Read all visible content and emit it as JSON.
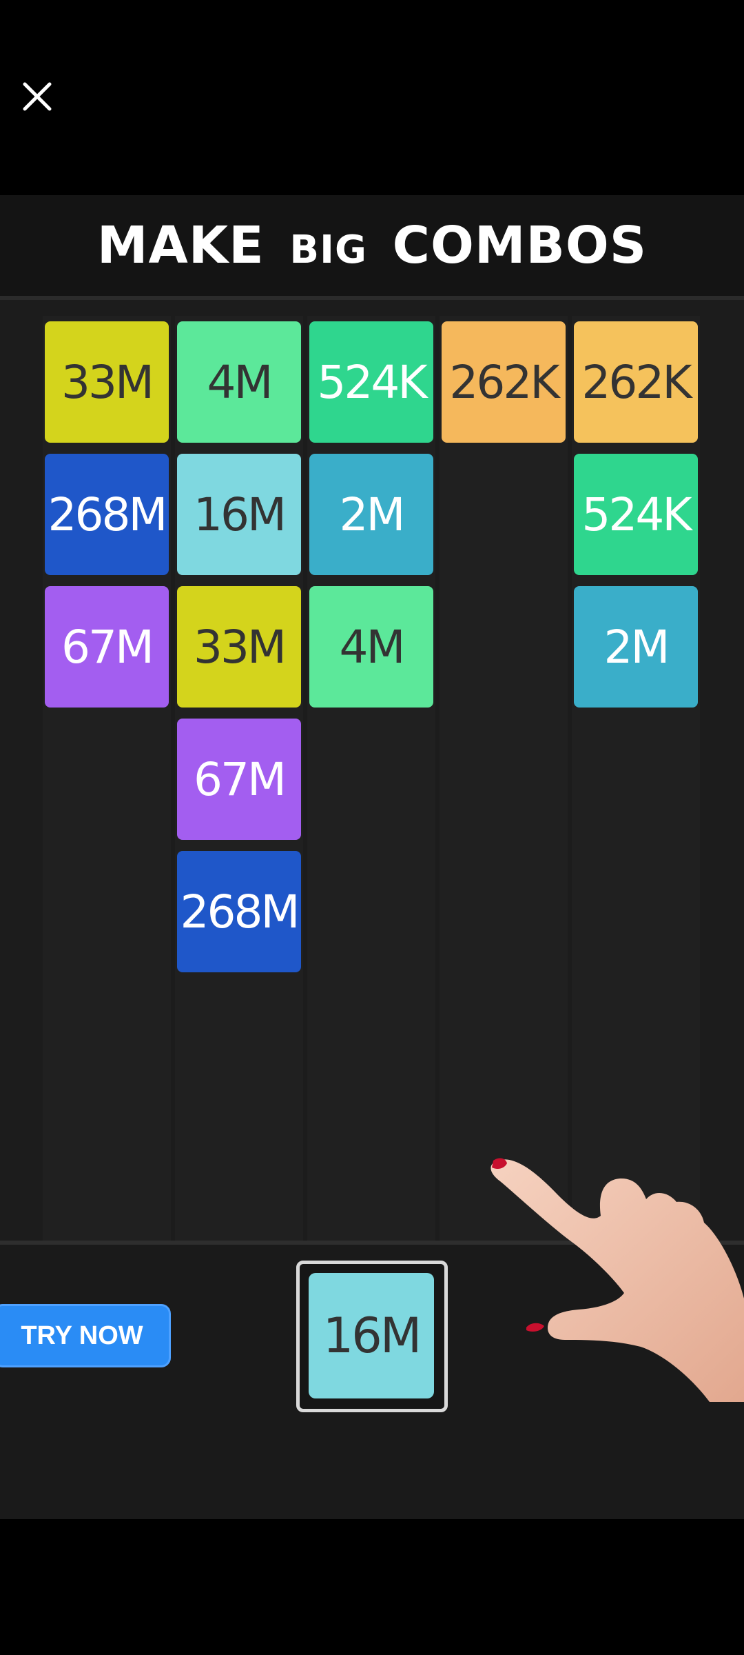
{
  "ad": {
    "headline_part1": "MAKE",
    "headline_part2": "BIG",
    "headline_part3": "COMBOS",
    "cta_label": "TRY NOW",
    "next_tile": {
      "value": "16M",
      "color": "#7fd8e0",
      "text_color": "#333333"
    }
  },
  "icons": {
    "close": "close-icon",
    "hand": "pointing-hand"
  },
  "columns": [
    {
      "tiles": [
        {
          "value": "33M",
          "color": "#d4d41c",
          "text_color": "#333333"
        },
        {
          "value": "268M",
          "color": "#1f57c9",
          "text_color": "#ffffff"
        },
        {
          "value": "67M",
          "color": "#a35ef0",
          "text_color": "#ffffff"
        }
      ]
    },
    {
      "tiles": [
        {
          "value": "4M",
          "color": "#5ce89a",
          "text_color": "#333333"
        },
        {
          "value": "16M",
          "color": "#7fd8e0",
          "text_color": "#333333"
        },
        {
          "value": "33M",
          "color": "#d4d41c",
          "text_color": "#333333"
        },
        {
          "value": "67M",
          "color": "#a35ef0",
          "text_color": "#ffffff"
        },
        {
          "value": "268M",
          "color": "#1f57c9",
          "text_color": "#ffffff"
        }
      ]
    },
    {
      "tiles": [
        {
          "value": "524K",
          "color": "#2fd68e",
          "text_color": "#ffffff"
        },
        {
          "value": "2M",
          "color": "#3aaec9",
          "text_color": "#ffffff"
        },
        {
          "value": "4M",
          "color": "#5ce89a",
          "text_color": "#333333"
        }
      ]
    },
    {
      "tiles": [
        {
          "value": "262K",
          "color": "#f5b85c",
          "text_color": "#333333"
        }
      ]
    },
    {
      "tiles": [
        {
          "value": "262K",
          "color": "#f5c25c",
          "text_color": "#333333"
        },
        {
          "value": "524K",
          "color": "#2fd68e",
          "text_color": "#ffffff"
        },
        {
          "value": "2M",
          "color": "#3aaec9",
          "text_color": "#ffffff"
        }
      ]
    }
  ]
}
